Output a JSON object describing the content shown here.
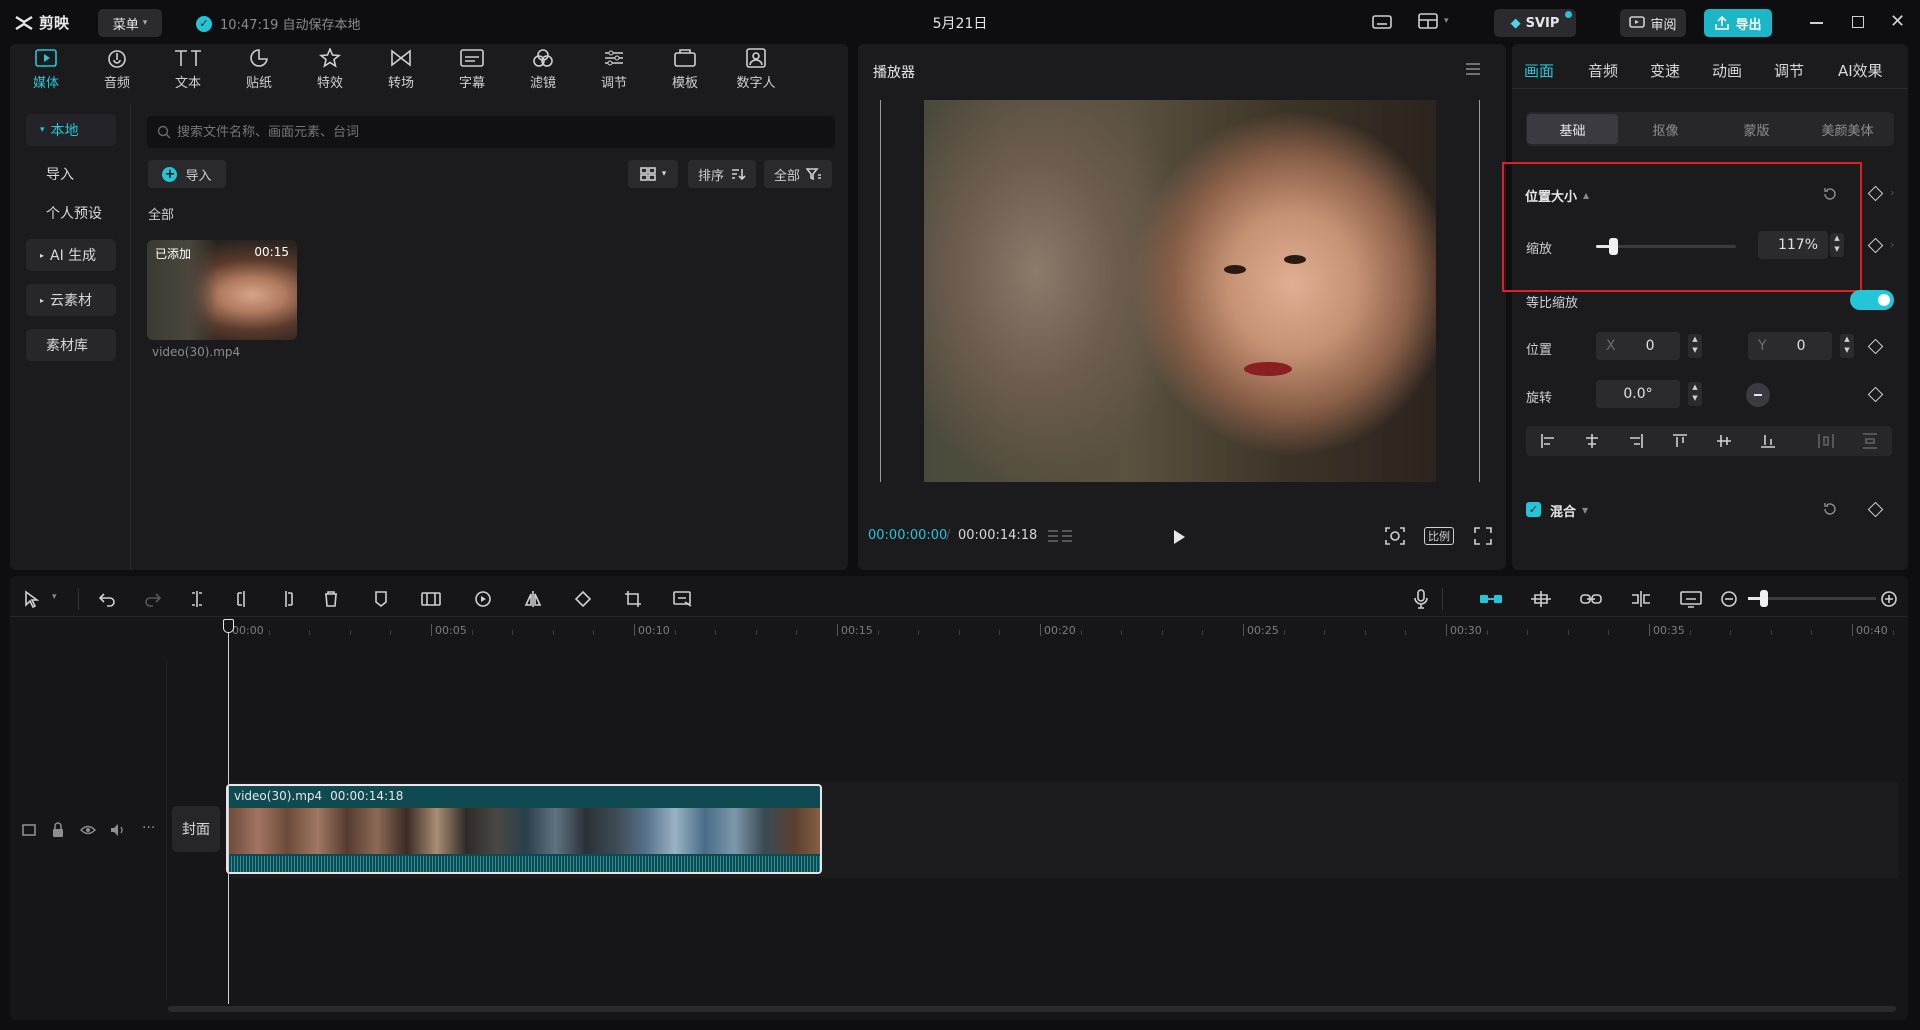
{
  "titlebar": {
    "app_name": "剪映",
    "menu_label": "菜单",
    "autosave_text": "10:47:19 自动保存本地",
    "project_title": "5月21日",
    "svip_label": "SVIP",
    "review_label": "审阅",
    "export_label": "导出"
  },
  "tools": [
    {
      "label": "媒体",
      "icon": "media-icon"
    },
    {
      "label": "音频",
      "icon": "audio-icon"
    },
    {
      "label": "文本",
      "icon": "text-icon"
    },
    {
      "label": "贴纸",
      "icon": "sticker-icon"
    },
    {
      "label": "特效",
      "icon": "effects-icon"
    },
    {
      "label": "转场",
      "icon": "transition-icon"
    },
    {
      "label": "字幕",
      "icon": "subtitle-icon"
    },
    {
      "label": "滤镜",
      "icon": "filter-icon"
    },
    {
      "label": "调节",
      "icon": "adjust-icon"
    },
    {
      "label": "模板",
      "icon": "template-icon"
    },
    {
      "label": "数字人",
      "icon": "digital-human-icon"
    }
  ],
  "media_sidebar": {
    "local": "本地",
    "import": "导入",
    "preset": "个人预设",
    "ai_gen": "AI 生成",
    "cloud": "云素材",
    "library": "素材库"
  },
  "media": {
    "search_placeholder": "搜索文件名称、画面元素、台词",
    "import_button": "导入",
    "sort_label": "排序",
    "filter_label": "全部",
    "section_all": "全部",
    "clip": {
      "badge": "已添加",
      "duration": "00:15",
      "filename": "video(30).mp4"
    }
  },
  "player": {
    "title": "播放器",
    "current_time": "00:00:00:00",
    "total_time": "00:00:14:18",
    "ratio_label": "比例"
  },
  "props": {
    "tabs": [
      "画面",
      "音频",
      "变速",
      "动画",
      "调节",
      "AI效果"
    ],
    "subtabs": [
      "基础",
      "抠像",
      "蒙版",
      "美颜美体"
    ],
    "section_pos_size": "位置大小",
    "scale_label": "缩放",
    "scale_value": "117%",
    "scale_fraction": 0.12,
    "uniform_scale_label": "等比缩放",
    "uniform_scale_on": true,
    "position_label": "位置",
    "x_label": "X",
    "x_value": "0",
    "y_label": "Y",
    "y_value": "0",
    "rotate_label": "旋转",
    "rotate_value": "0.0°",
    "blend_label": "混合"
  },
  "timeline": {
    "ruler": [
      "00:00",
      "00:05",
      "00:10",
      "00:15",
      "00:20",
      "00:25",
      "00:30",
      "00:35",
      "00:40"
    ],
    "cover_label": "封面",
    "clip_name": "video(30).mp4",
    "clip_duration": "00:00:14:18"
  },
  "colors": {
    "accent": "#22c6d6",
    "highlight_box": "#e02020",
    "export_bg": "#1db6c9",
    "clip_bg": "#0e4a4f"
  }
}
